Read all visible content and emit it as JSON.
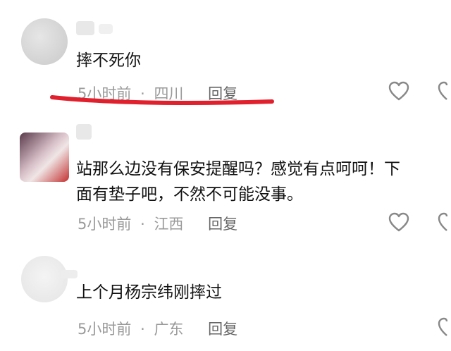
{
  "comments": [
    {
      "text": "摔不死你",
      "time": "5小时前",
      "location": "四川",
      "reply": "回复"
    },
    {
      "text_line1": "站那么边没有保安提醒吗？感觉有点呵呵！下",
      "text_line2": "面有垫子吧，不然不可能没事。",
      "time": "5小时前",
      "location": "江西",
      "reply": "回复"
    },
    {
      "text": "上个月杨宗纬刚摔过",
      "time": "5小时前",
      "location": "广东",
      "reply": "回复"
    }
  ],
  "meta_separator": "·",
  "colors": {
    "annotation_red": "#e0202c",
    "meta_gray": "#9a9a9a"
  }
}
